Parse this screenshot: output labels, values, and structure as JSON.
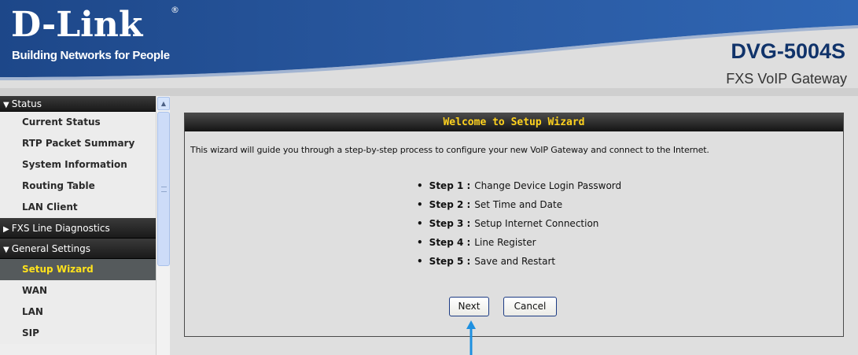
{
  "header": {
    "logo": "D-Link",
    "registered_mark": "®",
    "tagline": "Building Networks for People",
    "model": "DVG-5004S",
    "subtitle": "FXS VoIP Gateway"
  },
  "sidebar": {
    "sections": [
      {
        "label": "Status",
        "expanded": true,
        "items": [
          "Current Status",
          "RTP Packet Summary",
          "System Information",
          "Routing Table",
          "LAN Client"
        ]
      },
      {
        "label": "FXS Line Diagnostics",
        "expanded": false,
        "items": []
      },
      {
        "label": "General Settings",
        "expanded": true,
        "items": [
          "Setup Wizard",
          "WAN",
          "LAN",
          "SIP"
        ],
        "active_item": "Setup Wizard"
      }
    ],
    "expanded_marker": "▼",
    "collapsed_marker": "▶"
  },
  "wizard": {
    "title": "Welcome to Setup Wizard",
    "intro": "This wizard will guide you through a step-by-step process to configure your new VoIP Gateway and connect to the Internet.",
    "steps": [
      {
        "label": "Step 1",
        "text": "Change Device Login Password"
      },
      {
        "label": "Step 2",
        "text": "Set Time and Date"
      },
      {
        "label": "Step 3",
        "text": "Setup Internet Connection"
      },
      {
        "label": "Step 4",
        "text": "Line Register"
      },
      {
        "label": "Step 5",
        "text": "Save and Restart"
      }
    ],
    "buttons": {
      "next": "Next",
      "cancel": "Cancel"
    }
  },
  "colors": {
    "header_blue": "#1f4a8c",
    "title_yellow": "#ffd21e",
    "active_nav_text": "#ffe21c",
    "annotation_arrow": "#1e90e0"
  },
  "icons": {
    "scroll_up": "scroll-up-arrow-icon",
    "annotation": "pointer-arrow-icon"
  }
}
